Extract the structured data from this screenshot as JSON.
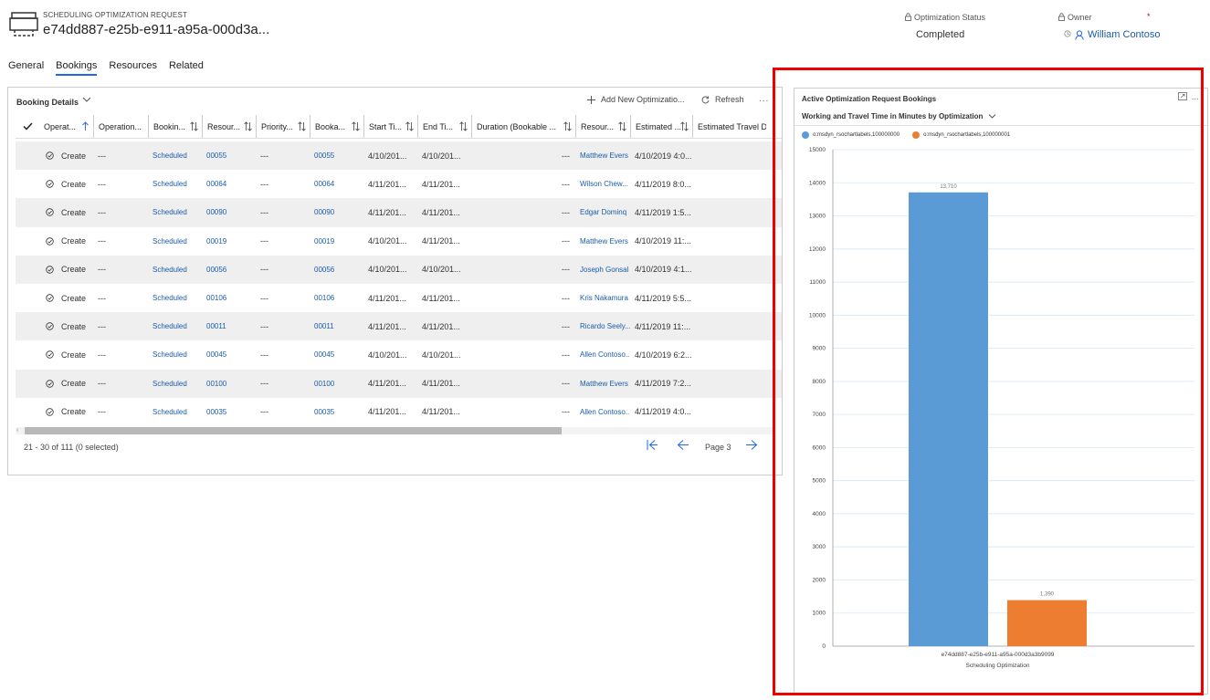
{
  "header": {
    "entity_type": "SCHEDULING OPTIMIZATION REQUEST",
    "record_title": "e74dd887-e25b-e911-a95a-000d3a...",
    "status_label": "Optimization Status",
    "status_value": "Completed",
    "owner_label": "Owner",
    "owner_value": "William Contoso",
    "required_mark": "*"
  },
  "tabs": [
    {
      "label": "General",
      "active": false
    },
    {
      "label": "Bookings",
      "active": true
    },
    {
      "label": "Resources",
      "active": false
    },
    {
      "label": "Related",
      "active": false
    }
  ],
  "grid": {
    "view_title": "Booking Details",
    "add_label": "Add New Optimizatio...",
    "refresh_label": "Refresh",
    "more": "...",
    "columns": [
      "Operat...",
      "Operation...",
      "Bookin...",
      "Resour...",
      "Priority...",
      "Booka...",
      "Start Ti...",
      "End Ti...",
      "Duration (Bookable ...",
      "Resour...",
      "Estimated ...",
      "Estimated Travel D"
    ],
    "rows": [
      {
        "op": "Create",
        "op2": "---",
        "status": "Scheduled",
        "res": "00055",
        "pri": "---",
        "book": "00055",
        "start": "4/10/201...",
        "end": "4/10/201...",
        "dur": "---",
        "resname": "Matthew Evers",
        "est": "4/10/2019 4:0..."
      },
      {
        "op": "Create",
        "op2": "---",
        "status": "Scheduled",
        "res": "00064",
        "pri": "---",
        "book": "00064",
        "start": "4/11/201...",
        "end": "4/11/201...",
        "dur": "---",
        "resname": "Wilson Chew...",
        "est": "4/11/2019 8:0..."
      },
      {
        "op": "Create",
        "op2": "---",
        "status": "Scheduled",
        "res": "00090",
        "pri": "---",
        "book": "00090",
        "start": "4/11/201...",
        "end": "4/11/201...",
        "dur": "---",
        "resname": "Edgar Dominq",
        "est": "4/11/2019 1:5..."
      },
      {
        "op": "Create",
        "op2": "---",
        "status": "Scheduled",
        "res": "00019",
        "pri": "---",
        "book": "00019",
        "start": "4/10/201...",
        "end": "4/11/201...",
        "dur": "---",
        "resname": "Matthew Evers",
        "est": "4/10/2019 11:..."
      },
      {
        "op": "Create",
        "op2": "---",
        "status": "Scheduled",
        "res": "00056",
        "pri": "---",
        "book": "00056",
        "start": "4/10/201...",
        "end": "4/10/201...",
        "dur": "---",
        "resname": "Joseph Gonsal",
        "est": "4/10/2019 4:1..."
      },
      {
        "op": "Create",
        "op2": "---",
        "status": "Scheduled",
        "res": "00106",
        "pri": "---",
        "book": "00106",
        "start": "4/11/201...",
        "end": "4/11/201...",
        "dur": "---",
        "resname": "Kris Nakamura",
        "est": "4/11/2019 5:5..."
      },
      {
        "op": "Create",
        "op2": "---",
        "status": "Scheduled",
        "res": "00011",
        "pri": "---",
        "book": "00011",
        "start": "4/11/201...",
        "end": "4/11/201...",
        "dur": "---",
        "resname": "Ricardo Seely...",
        "est": "4/11/2019 11:..."
      },
      {
        "op": "Create",
        "op2": "---",
        "status": "Scheduled",
        "res": "00045",
        "pri": "---",
        "book": "00045",
        "start": "4/10/201...",
        "end": "4/10/201...",
        "dur": "---",
        "resname": "Allen Contoso...",
        "est": "4/10/2019 6:2..."
      },
      {
        "op": "Create",
        "op2": "---",
        "status": "Scheduled",
        "res": "00100",
        "pri": "---",
        "book": "00100",
        "start": "4/11/201...",
        "end": "4/11/201...",
        "dur": "---",
        "resname": "Matthew Evers",
        "est": "4/11/2019 7:2..."
      },
      {
        "op": "Create",
        "op2": "---",
        "status": "Scheduled",
        "res": "00035",
        "pri": "---",
        "book": "00035",
        "start": "4/11/201...",
        "end": "4/11/201...",
        "dur": "---",
        "resname": "Allen Contoso...",
        "est": "4/11/2019 4:0..."
      }
    ],
    "record_count": "21 - 30 of 111 (0 selected)",
    "page_label": "Page 3"
  },
  "chart_panel": {
    "title": "Active Optimization Request Bookings",
    "view": "Working and Travel Time in Minutes by Optimization",
    "more": "..."
  },
  "chart_data": {
    "type": "bar",
    "categories": [
      "e74dd887-e25b-e911-a95a-000d3a3b9099"
    ],
    "series": [
      {
        "name": "o:msdyn_rsochartlabels,100000000",
        "values": [
          13710
        ],
        "labels": [
          "13,710"
        ],
        "color": "#5b9bd5"
      },
      {
        "name": "o:msdyn_rsochartlabels,100000001",
        "values": [
          1390
        ],
        "labels": [
          "1,390"
        ],
        "color": "#ed7d31"
      }
    ],
    "xlabel": "Scheduling Optimization",
    "ylabel": "",
    "ylim": [
      0,
      15000
    ],
    "yticks": [
      0,
      1000,
      2000,
      3000,
      4000,
      5000,
      6000,
      7000,
      8000,
      9000,
      10000,
      11000,
      12000,
      13000,
      14000,
      15000
    ],
    "grid": true,
    "legend_position": "top-left"
  }
}
